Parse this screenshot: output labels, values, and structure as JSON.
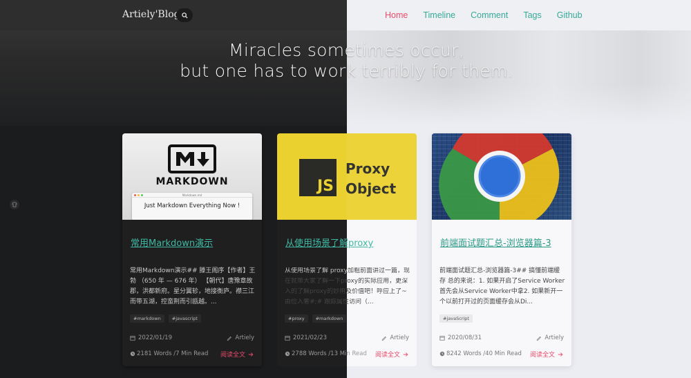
{
  "nav": {
    "brand": "Artiely'Blog",
    "links": [
      "Home",
      "Timeline",
      "Comment",
      "Tags",
      "Github"
    ],
    "active": "Home"
  },
  "hero": {
    "quote_line1": "Miracles sometimes occur,",
    "quote_line2": "but one has to work terribly for them."
  },
  "colors": {
    "accent": "#3fb9a3",
    "active_nav": "#ec4d6b",
    "read_more": "#e8496a",
    "dark_bg": "#1b1c1e",
    "light_bg": "#ecedf2"
  },
  "cards": [
    {
      "cover": {
        "logo_text": "MARKDOWN",
        "window_title": "Markdown.md",
        "window_text": "Just Markdown Everything Now !"
      },
      "title": "常用Markdown演示",
      "excerpt": "常用Markdown演示## 滕王阁序【作者】王勃 （650 年 — 676 年） 【朝代】唐豫章故郡，洪都新府。星分翼轸，地接衡庐。襟三江而带五湖，控蛮荆而引瓯越。...",
      "tags": [
        "#markdown",
        "#javascript"
      ],
      "date": "2022/01/19",
      "author": "Artiely",
      "words": "2181 Words /7 Min Read",
      "read_more": "阅读全文"
    },
    {
      "cover": {
        "js_label": "JS",
        "text": "Proxy\nObject"
      },
      "title": "从使用场景了解proxy",
      "excerpt": "从使用场景了解 proxy加粗前面讲过一篇，现在就带大家了解一下proxy的实际应用，更深入的了解proxy的妙用及价值吧！呼应上了~由俭入奢#;# 跟踪属性访问（...",
      "tags": [
        "#proxy",
        "#markdown"
      ],
      "date": "2021/02/23",
      "author": "Artiely",
      "words": "2788 Words /13 Min Read",
      "read_more": "阅读全文"
    },
    {
      "cover": {},
      "title": "前端面试题汇总-浏览器篇-3",
      "excerpt": "前端面试题汇总-浏览器篇-3## 搞懂前端缓存 总的来说：1. 如果开启了Service Worker首先会从Service Worker中拿2. 如果新开一个以前打开过的页面缓存会从Di...",
      "tags": [
        "#javaScript"
      ],
      "date": "2020/08/31",
      "author": "Artiely",
      "words": "8242 Words /40 Min Read",
      "read_more": "阅读全文"
    }
  ]
}
